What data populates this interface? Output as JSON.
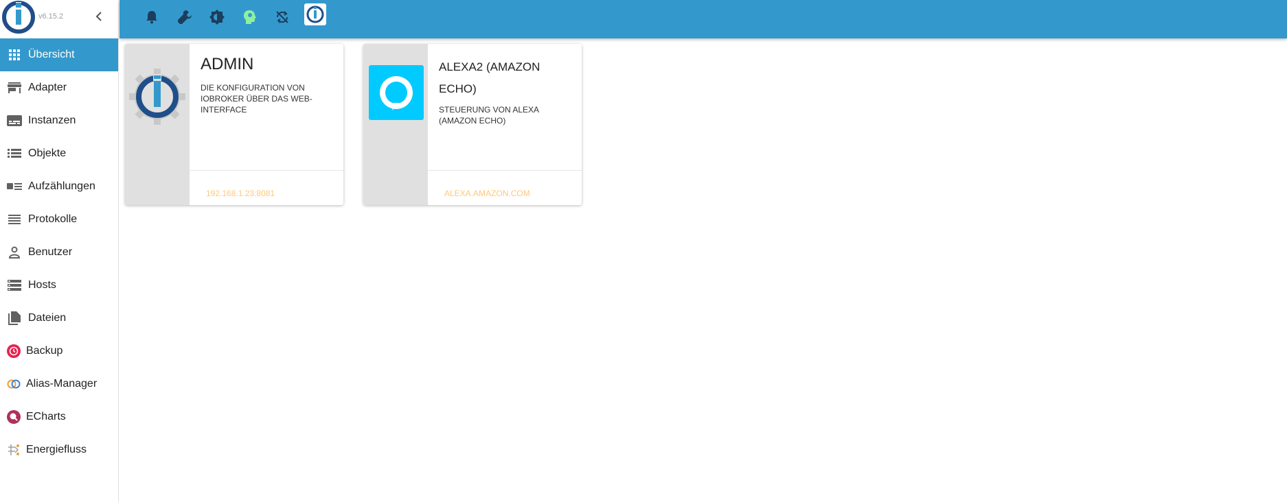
{
  "app": {
    "version": "v6.15.2",
    "brand_color": "#3399cc"
  },
  "sidebar": {
    "items": [
      {
        "label": "Übersicht",
        "icon": "grid-icon",
        "active": true
      },
      {
        "label": "Adapter",
        "icon": "store-icon"
      },
      {
        "label": "Instanzen",
        "icon": "subtitles-icon"
      },
      {
        "label": "Objekte",
        "icon": "list-icon"
      },
      {
        "label": "Aufzählungen",
        "icon": "enum-icon"
      },
      {
        "label": "Protokolle",
        "icon": "lines-icon"
      },
      {
        "label": "Benutzer",
        "icon": "person-icon"
      },
      {
        "label": "Hosts",
        "icon": "storage-icon"
      },
      {
        "label": "Dateien",
        "icon": "files-icon"
      },
      {
        "label": "Backup",
        "icon": "backup-icon"
      },
      {
        "label": "Alias-Manager",
        "icon": "alias-icon"
      },
      {
        "label": "ECharts",
        "icon": "echarts-icon"
      },
      {
        "label": "Energiefluss",
        "icon": "energy-icon"
      }
    ]
  },
  "topbar": {
    "buttons": [
      "bell-icon",
      "wrench-icon",
      "brightness-icon",
      "expert-mode-icon",
      "sync-off-icon",
      "iobroker-icon"
    ]
  },
  "cards": [
    {
      "title": "ADMIN",
      "description": "Die Konfiguration von ioBroker über das Web-Interface",
      "link": "192.168.1.23:8081"
    },
    {
      "title": "ALEXA2 (AMAZON ECHO)",
      "description": "Steuerung von Alexa (Amazon Echo)",
      "link": "ALEXA.AMAZON.COM"
    }
  ]
}
